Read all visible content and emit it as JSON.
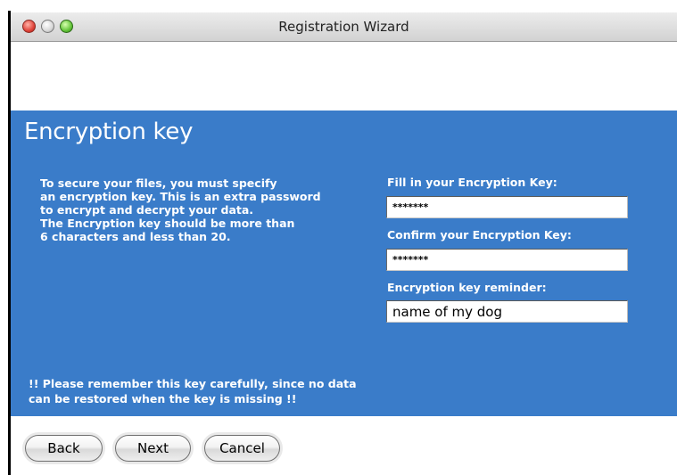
{
  "window": {
    "title": "Registration Wizard"
  },
  "page": {
    "heading": "Encryption key",
    "description_lines": [
      "To secure your files, you must specify",
      "an encryption key. This is an extra password",
      "to encrypt and decrypt your data.",
      "The Encryption key should be more than",
      "6 characters and less than 20."
    ],
    "warning_lines": [
      "!! Please remember this key carefully, since no data",
      "can be restored when the key is missing !!"
    ]
  },
  "form": {
    "key_label": "Fill in your Encryption Key:",
    "key_value": "*******",
    "confirm_label": "Confirm your Encryption Key:",
    "confirm_value": "*******",
    "reminder_label": "Encryption key reminder:",
    "reminder_value": "name of my dog"
  },
  "buttons": {
    "back": "Back",
    "next": "Next",
    "cancel": "Cancel"
  },
  "colors": {
    "panel_background": "#3a7cc9",
    "panel_text": "#ffffff"
  }
}
